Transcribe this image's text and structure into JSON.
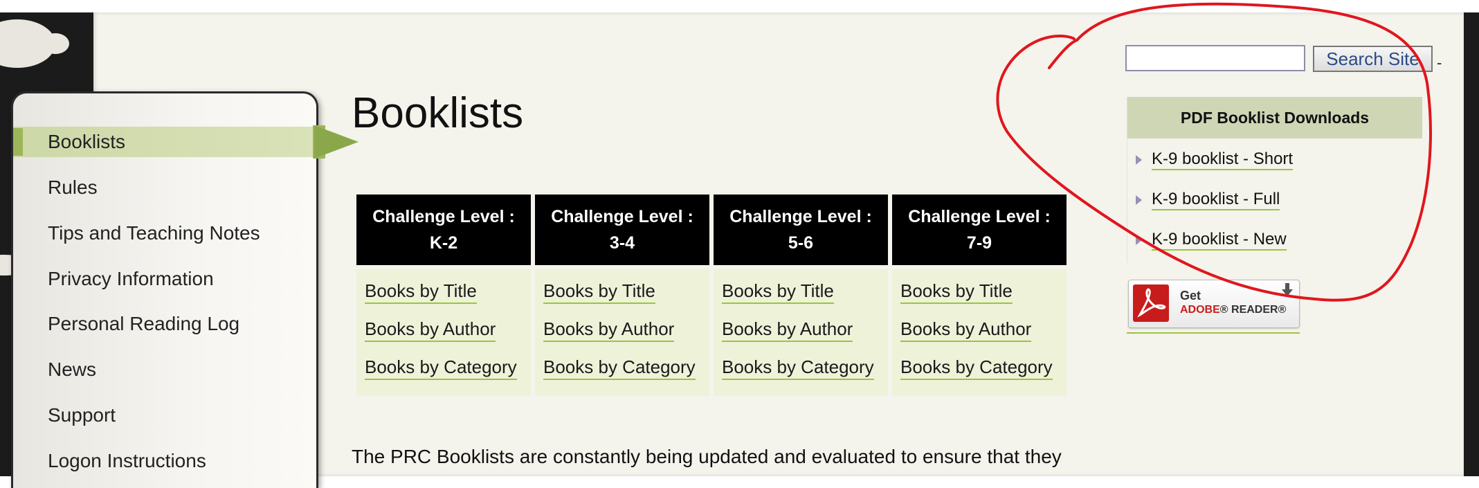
{
  "nav": {
    "items": [
      {
        "label": "Booklists",
        "active": true
      },
      {
        "label": "Rules"
      },
      {
        "label": "Tips and Teaching Notes"
      },
      {
        "label": "Privacy Information"
      },
      {
        "label": "Personal Reading Log"
      },
      {
        "label": "News"
      },
      {
        "label": "Support"
      },
      {
        "label": "Logon Instructions"
      }
    ]
  },
  "page": {
    "title": "Booklists",
    "intro": "The PRC Booklists are constantly being updated and evaluated to ensure that they"
  },
  "levels": [
    {
      "heading_line1": "Challenge Level :",
      "heading_line2": "K-2",
      "links": [
        "Books by Title",
        "Books by Author",
        "Books by Category"
      ]
    },
    {
      "heading_line1": "Challenge Level :",
      "heading_line2": "3-4",
      "links": [
        "Books by Title",
        "Books by Author",
        "Books by Category"
      ]
    },
    {
      "heading_line1": "Challenge Level :",
      "heading_line2": "5-6",
      "links": [
        "Books by Title",
        "Books by Author",
        "Books by Category"
      ]
    },
    {
      "heading_line1": "Challenge Level :",
      "heading_line2": "7-9",
      "links": [
        "Books by Title",
        "Books by Author",
        "Books by Category"
      ]
    }
  ],
  "search": {
    "input_value": "",
    "button_label": "Search Site",
    "trailing": "-"
  },
  "pdf_downloads": {
    "heading": "PDF Booklist Downloads",
    "links": [
      "K-9 booklist - Short",
      "K-9 booklist - Full",
      "K-9 booklist - New"
    ]
  },
  "adobe_badge": {
    "get": "Get",
    "brand": "ADOBE",
    "product": "READER"
  },
  "colors": {
    "accent_green": "#9cc43c",
    "annotation_red": "#e0161e"
  }
}
